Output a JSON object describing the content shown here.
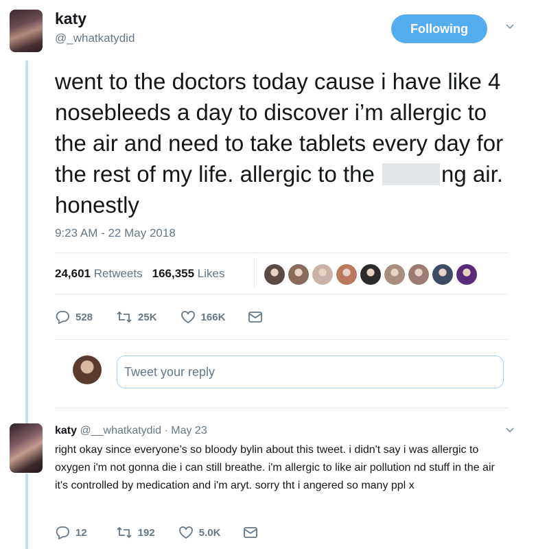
{
  "tweet": {
    "name": "katy",
    "handle": "@_whatkatydid",
    "follow_label": "Following",
    "text_before": "went to the doctors today cause i have like 4 nosebleeds a day to discover i’m allergic to the air and need to take tablets every day for the rest of my life. allergic to the",
    "text_after": "ng air. honestly",
    "timestamp": "9:23 AM - 22 May 2018",
    "retweets_count": "24,601",
    "retweets_label": "Retweets",
    "likes_count": "166,355",
    "likes_label": "Likes",
    "actions": {
      "replies": "528",
      "retweets": "25K",
      "likes": "166K"
    }
  },
  "liker_colors": [
    "#5b4a46",
    "#8a6b59",
    "#c9b3a8",
    "#b8795f",
    "#2d2a2b",
    "#a88d80",
    "#9c7b74",
    "#3f4a63",
    "#5a2a7a"
  ],
  "reply_box": {
    "placeholder": "Tweet your reply"
  },
  "reply": {
    "name": "katy",
    "handle": "@__whatkatydid",
    "date": "· May 23",
    "text": "right okay since everyone’s so bloody bylin about this tweet. i didn't say i was allergic to oxygen i'm not gonna die i can still breathe. i'm allergic to like air pollution nd stuff in the air it's controlled by medication and i'm aryt. sorry tht i angered so many ppl x",
    "actions": {
      "replies": "12",
      "retweets": "192",
      "likes": "5.0K"
    }
  },
  "colors": {
    "accent": "#55adee",
    "secondary_text": "#657786",
    "thread_line": "#bfe0f6"
  }
}
